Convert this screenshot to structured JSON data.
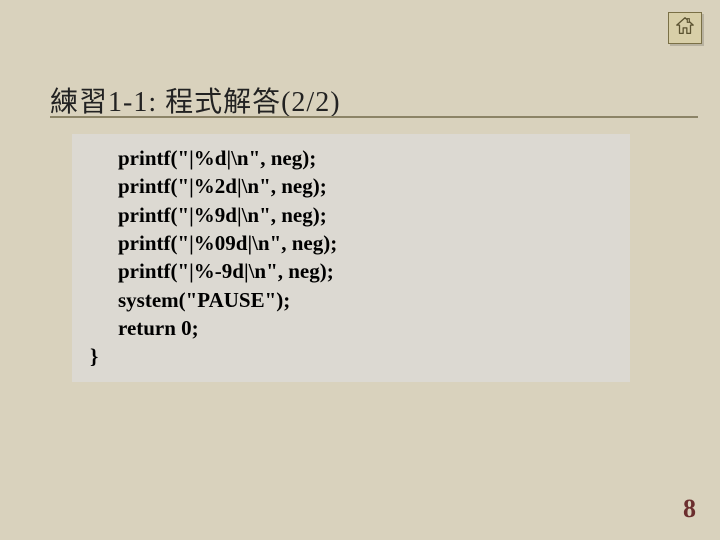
{
  "nav": {
    "home_icon": "home-icon"
  },
  "title": "練習1-1: 程式解答(2/2)",
  "code": {
    "lines": [
      "printf(\"|%d|\\n\", neg);",
      "printf(\"|%2d|\\n\", neg);",
      "printf(\"|%9d|\\n\", neg);",
      "printf(\"|%09d|\\n\", neg);",
      "printf(\"|%-9d|\\n\", neg);",
      "system(\"PAUSE\");",
      "return 0;"
    ],
    "closing_brace": "}"
  },
  "page_number": "8"
}
